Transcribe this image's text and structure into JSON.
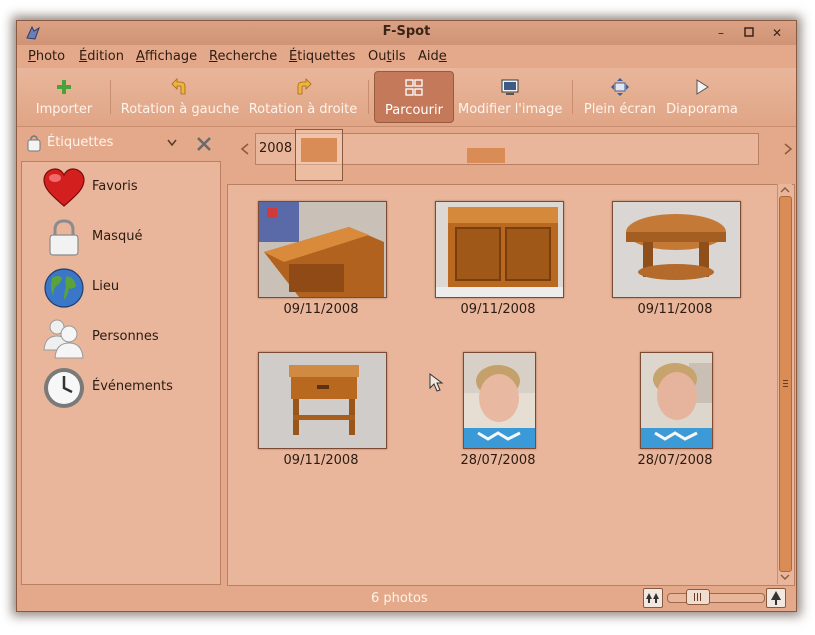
{
  "window": {
    "title": "F-Spot"
  },
  "menubar": {
    "items": [
      {
        "accel": "P",
        "rest": "hoto"
      },
      {
        "accel": "É",
        "rest": "dition"
      },
      {
        "accel": "A",
        "rest": "ffichage"
      },
      {
        "accel": "R",
        "rest": "echerche"
      },
      {
        "accel": "É",
        "rest": "tiquettes"
      },
      {
        "pre": "Ou",
        "accel": "t",
        "rest": "ils"
      },
      {
        "pre": "Aid",
        "accel": "e",
        "rest": ""
      }
    ]
  },
  "toolbar": {
    "import": "Importer",
    "rotate_left": "Rotation à gauche",
    "rotate_right": "Rotation à droite",
    "browse": "Parcourir",
    "edit_image": "Modifier l'image",
    "fullscreen": "Plein écran",
    "slideshow": "Diaporama"
  },
  "sidebar": {
    "selector_label": "Étiquettes",
    "items": [
      {
        "label": "Favoris",
        "icon": "heart-icon"
      },
      {
        "label": "Masqué",
        "icon": "padlock-icon"
      },
      {
        "label": "Lieu",
        "icon": "globe-icon"
      },
      {
        "label": "Personnes",
        "icon": "people-icon"
      },
      {
        "label": "Événements",
        "icon": "clock-icon"
      }
    ]
  },
  "timeline": {
    "year": "2008"
  },
  "photos": [
    {
      "date": "09/11/2008",
      "kind": "cabinet-corner"
    },
    {
      "date": "09/11/2008",
      "kind": "cabinet-front"
    },
    {
      "date": "09/11/2008",
      "kind": "round-table"
    },
    {
      "date": "09/11/2008",
      "kind": "nightstand"
    },
    {
      "date": "28/07/2008",
      "kind": "child-portrait"
    },
    {
      "date": "28/07/2008",
      "kind": "child-portrait"
    }
  ],
  "status": {
    "count": "6 photos",
    "zoom_level": 0.25
  },
  "colors": {
    "accent": "#d98c55",
    "window_bg": "#e3a98a",
    "active_tool": "#c4795a"
  }
}
